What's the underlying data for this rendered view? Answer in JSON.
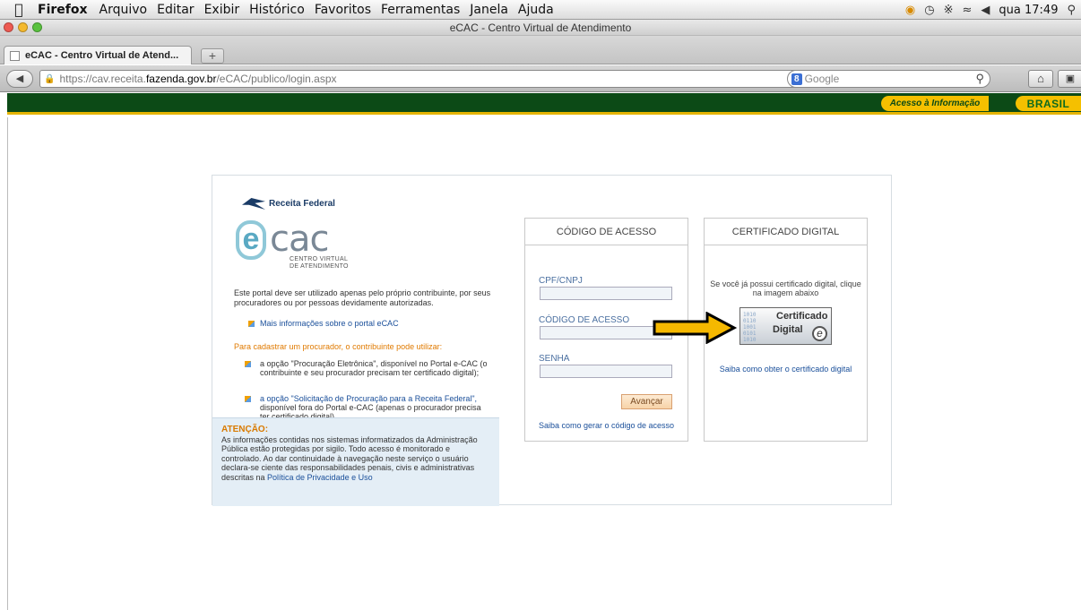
{
  "menubar": {
    "app": "Firefox",
    "items": [
      "Arquivo",
      "Editar",
      "Exibir",
      "Histórico",
      "Favoritos",
      "Ferramentas",
      "Janela",
      "Ajuda"
    ],
    "clock": "qua 17:49"
  },
  "window": {
    "title": "eCAC - Centro Virtual de Atendimento"
  },
  "tabs": [
    {
      "label": "eCAC - Centro Virtual de Atend..."
    }
  ],
  "newtab": "+",
  "url": {
    "prefix": "https://cav.receita.",
    "domain": "fazenda.gov.br",
    "path": "/eCAC/publico/login.aspx"
  },
  "search": {
    "engine": "8",
    "placeholder": "Google"
  },
  "govbar": {
    "acesso": "Acesso à Informação",
    "brasil": "BRASIL"
  },
  "left": {
    "rf_logo": "Receita Federal",
    "ecac_word": "cac",
    "ecac_e": "e",
    "ecac_sub1": "CENTRO VIRTUAL",
    "ecac_sub2": "DE ATENDIMENTO",
    "intro": "Este portal deve ser utilizado apenas pelo próprio contribuinte, por seus procuradores ou por pessoas devidamente autorizadas.",
    "mais_info": "Mais informações sobre o portal eCAC",
    "para_cadastrar": "Para cadastrar um procurador, o contribuinte pode utilizar:",
    "opt1_pre": "a opção \"Procuração Eletrônica\", disponível no Portal e-CAC (o contribuinte e seu procurador precisam ter certificado digital);",
    "opt2_link": "a opção \"Solicitação de Procuração para a Receita Federal\",",
    "opt2_rest": "disponível fora do Portal e-CAC (apenas o procurador precisa ter certificado digital)",
    "atencao_title": "ATENÇÃO:",
    "atencao_body": "As informações contidas nos sistemas informatizados da Administração Pública estão protegidas por sigilo. Todo acesso é monitorado e controlado. Ao dar continuidade à navegação neste serviço o usuário declara-se ciente das responsabilidades penais, civis e administrativas descritas na ",
    "atencao_link": "Política de Privacidade e Uso"
  },
  "codigo": {
    "title": "CÓDIGO DE ACESSO",
    "cpf_label": "CPF/CNPJ",
    "codigo_label": "CÓDIGO DE ACESSO",
    "senha_label": "SENHA",
    "button": "Avançar",
    "link": "Saiba como gerar o código de acesso"
  },
  "certificado": {
    "title": "CERTIFICADO DIGITAL",
    "text": "Se você já possui certificado digital, clique na imagem abaixo",
    "img_line1": "Certificado",
    "img_line2": "Digital",
    "link": "Saiba como obter o certificado digital"
  },
  "colors": {
    "gov_green": "#0c4a16",
    "gov_yellow": "#f5c000",
    "arrow": "#f5b800"
  }
}
